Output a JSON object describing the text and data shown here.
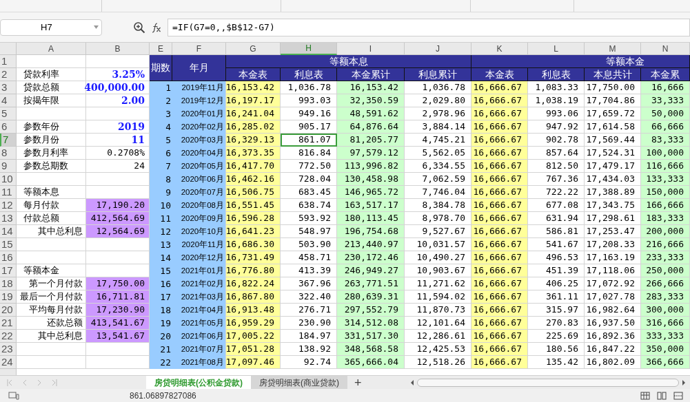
{
  "name_box": "H7",
  "formula": "=IF(G7=0,,$B$12-G7)",
  "columns": [
    {
      "letter": "A",
      "selected": false
    },
    {
      "letter": "B",
      "selected": false
    },
    {
      "letter": "E",
      "selected": false
    },
    {
      "letter": "F",
      "selected": false
    },
    {
      "letter": "G",
      "selected": false
    },
    {
      "letter": "H",
      "selected": true
    },
    {
      "letter": "I",
      "selected": false
    },
    {
      "letter": "J",
      "selected": false
    },
    {
      "letter": "K",
      "selected": false
    },
    {
      "letter": "L",
      "selected": false
    },
    {
      "letter": "M",
      "selected": false
    },
    {
      "letter": "N",
      "selected": false
    }
  ],
  "row_numbers": [
    {
      "label": "1",
      "selected": false
    },
    {
      "label": "2",
      "selected": false
    },
    {
      "label": "3",
      "selected": false
    },
    {
      "label": "4",
      "selected": false
    },
    {
      "label": "5",
      "selected": false
    },
    {
      "label": "6",
      "selected": false
    },
    {
      "label": "7",
      "selected": true
    },
    {
      "label": "8",
      "selected": false
    },
    {
      "label": "9",
      "selected": false
    },
    {
      "label": "10",
      "selected": false
    },
    {
      "label": "11",
      "selected": false
    },
    {
      "label": "12",
      "selected": false
    },
    {
      "label": "13",
      "selected": false
    },
    {
      "label": "14",
      "selected": false
    },
    {
      "label": "15",
      "selected": false
    },
    {
      "label": "16",
      "selected": false
    },
    {
      "label": "17",
      "selected": false
    },
    {
      "label": "18",
      "selected": false
    },
    {
      "label": "19",
      "selected": false
    },
    {
      "label": "20",
      "selected": false
    },
    {
      "label": "21",
      "selected": false
    },
    {
      "label": "22",
      "selected": false
    },
    {
      "label": "23",
      "selected": false
    },
    {
      "label": "24",
      "selected": false
    }
  ],
  "left_rows": [
    {},
    {
      "label": "贷款利率",
      "value": "3.25%",
      "kind": "input"
    },
    {
      "label": "贷款总额",
      "value": "400,000.00",
      "kind": "input"
    },
    {
      "label": "按揭年限",
      "value": "2.00",
      "kind": "input"
    },
    {},
    {
      "label": "参数年份",
      "value": "2019",
      "kind": "input"
    },
    {
      "label": "参数月份",
      "value": "11",
      "kind": "input"
    },
    {
      "label": "参数月利率",
      "value": "0.2708%",
      "kind": "plain"
    },
    {
      "label": "参数总期数",
      "value": "24",
      "kind": "plain"
    },
    {},
    {
      "label": "等额本息"
    },
    {
      "label": "每月付款",
      "value": "17,190.20",
      "kind": "result"
    },
    {
      "label": "付款总额",
      "value": "412,564.69",
      "kind": "result"
    },
    {
      "label": "其中总利息",
      "value": "12,564.69",
      "kind": "result",
      "right_aligned": true
    },
    {},
    {},
    {
      "label": "等额本金"
    },
    {
      "label": "第一个月付款",
      "value": "17,750.00",
      "kind": "result",
      "right_aligned": true
    },
    {
      "label": "最后一个月付款",
      "value": "16,711.81",
      "kind": "result",
      "right_aligned": true
    },
    {
      "label": "平均每月付款",
      "value": "17,230.90",
      "kind": "result",
      "right_aligned": true
    },
    {
      "label": "还款总额",
      "value": "413,541.67",
      "kind": "result",
      "right_aligned": true
    },
    {
      "label": "其中总利息",
      "value": "13,541.67",
      "kind": "result",
      "right_aligned": true
    },
    {},
    {}
  ],
  "schedule": {
    "period_header": "期数",
    "month_header": "年月",
    "groups": [
      {
        "label": "等额本息",
        "headers": [
          {
            "label": "本金表",
            "color": "#ffff99"
          },
          {
            "label": "利息表",
            "color": "#ffffff"
          },
          {
            "label": "本金累计",
            "color": "#ccffcc"
          },
          {
            "label": "利息累计",
            "color": "#ffffff"
          }
        ]
      },
      {
        "label": "等额本金",
        "headers": [
          {
            "label": "本金表",
            "color": "#ffff99"
          },
          {
            "label": "利息表",
            "color": "#ffffff"
          },
          {
            "label": "本息共计",
            "color": "#ffffff"
          },
          {
            "label": "本金累",
            "color": "#ccffcc"
          }
        ]
      }
    ],
    "rows": [
      {
        "period": "1",
        "month": "2019年11月",
        "cells": [
          "16,153.42",
          "1,036.78",
          "16,153.42",
          "1,036.78",
          "16,666.67",
          "1,083.33",
          "17,750.00",
          "16,666"
        ]
      },
      {
        "period": "2",
        "month": "2019年12月",
        "cells": [
          "16,197.17",
          "993.03",
          "32,350.59",
          "2,029.80",
          "16,666.67",
          "1,038.19",
          "17,704.86",
          "33,333"
        ]
      },
      {
        "period": "3",
        "month": "2020年01月",
        "cells": [
          "16,241.04",
          "949.16",
          "48,591.62",
          "2,978.96",
          "16,666.67",
          "993.06",
          "17,659.72",
          "50,000"
        ]
      },
      {
        "period": "4",
        "month": "2020年02月",
        "cells": [
          "16,285.02",
          "905.17",
          "64,876.64",
          "3,884.14",
          "16,666.67",
          "947.92",
          "17,614.58",
          "66,666"
        ]
      },
      {
        "period": "5",
        "month": "2020年03月",
        "cells": [
          "16,329.13",
          "861.07",
          "81,205.77",
          "4,745.21",
          "16,666.67",
          "902.78",
          "17,569.44",
          "83,333"
        ]
      },
      {
        "period": "6",
        "month": "2020年04月",
        "cells": [
          "16,373.35",
          "816.84",
          "97,579.12",
          "5,562.05",
          "16,666.67",
          "857.64",
          "17,524.31",
          "100,000"
        ]
      },
      {
        "period": "7",
        "month": "2020年05月",
        "cells": [
          "16,417.70",
          "772.50",
          "113,996.82",
          "6,334.55",
          "16,666.67",
          "812.50",
          "17,479.17",
          "116,666"
        ]
      },
      {
        "period": "8",
        "month": "2020年06月",
        "cells": [
          "16,462.16",
          "728.04",
          "130,458.98",
          "7,062.59",
          "16,666.67",
          "767.36",
          "17,434.03",
          "133,333"
        ]
      },
      {
        "period": "9",
        "month": "2020年07月",
        "cells": [
          "16,506.75",
          "683.45",
          "146,965.72",
          "7,746.04",
          "16,666.67",
          "722.22",
          "17,388.89",
          "150,000"
        ]
      },
      {
        "period": "10",
        "month": "2020年08月",
        "cells": [
          "16,551.45",
          "638.74",
          "163,517.17",
          "8,384.78",
          "16,666.67",
          "677.08",
          "17,343.75",
          "166,666"
        ]
      },
      {
        "period": "11",
        "month": "2020年09月",
        "cells": [
          "16,596.28",
          "593.92",
          "180,113.45",
          "8,978.70",
          "16,666.67",
          "631.94",
          "17,298.61",
          "183,333"
        ]
      },
      {
        "period": "12",
        "month": "2020年10月",
        "cells": [
          "16,641.23",
          "548.97",
          "196,754.68",
          "9,527.67",
          "16,666.67",
          "586.81",
          "17,253.47",
          "200,000"
        ]
      },
      {
        "period": "13",
        "month": "2020年11月",
        "cells": [
          "16,686.30",
          "503.90",
          "213,440.97",
          "10,031.57",
          "16,666.67",
          "541.67",
          "17,208.33",
          "216,666"
        ]
      },
      {
        "period": "14",
        "month": "2020年12月",
        "cells": [
          "16,731.49",
          "458.71",
          "230,172.46",
          "10,490.27",
          "16,666.67",
          "496.53",
          "17,163.19",
          "233,333"
        ]
      },
      {
        "period": "15",
        "month": "2021年01月",
        "cells": [
          "16,776.80",
          "413.39",
          "246,949.27",
          "10,903.67",
          "16,666.67",
          "451.39",
          "17,118.06",
          "250,000"
        ]
      },
      {
        "period": "16",
        "month": "2021年02月",
        "cells": [
          "16,822.24",
          "367.96",
          "263,771.51",
          "11,271.62",
          "16,666.67",
          "406.25",
          "17,072.92",
          "266,666"
        ]
      },
      {
        "period": "17",
        "month": "2021年03月",
        "cells": [
          "16,867.80",
          "322.40",
          "280,639.31",
          "11,594.02",
          "16,666.67",
          "361.11",
          "17,027.78",
          "283,333"
        ]
      },
      {
        "period": "18",
        "month": "2021年04月",
        "cells": [
          "16,913.48",
          "276.71",
          "297,552.79",
          "11,870.73",
          "16,666.67",
          "315.97",
          "16,982.64",
          "300,000"
        ]
      },
      {
        "period": "19",
        "month": "2021年05月",
        "cells": [
          "16,959.29",
          "230.90",
          "314,512.08",
          "12,101.64",
          "16,666.67",
          "270.83",
          "16,937.50",
          "316,666"
        ]
      },
      {
        "period": "20",
        "month": "2021年06月",
        "cells": [
          "17,005.22",
          "184.97",
          "331,517.30",
          "12,286.61",
          "16,666.67",
          "225.69",
          "16,892.36",
          "333,333"
        ]
      },
      {
        "period": "21",
        "month": "2021年07月",
        "cells": [
          "17,051.28",
          "138.92",
          "348,568.58",
          "12,425.53",
          "16,666.67",
          "180.56",
          "16,847.22",
          "350,000"
        ]
      },
      {
        "period": "22",
        "month": "2021年08月",
        "cells": [
          "17,097.46",
          "92.74",
          "365,666.04",
          "12,518.26",
          "16,666.67",
          "135.42",
          "16,802.09",
          "366,666"
        ]
      }
    ]
  },
  "sheet_tabs": [
    {
      "label": "房贷明细表(公积金贷款)",
      "selected": true
    },
    {
      "label": "房贷明细表(商业贷款)",
      "selected": false
    }
  ],
  "add_sheet": "+",
  "status_value": "861.06897827086"
}
